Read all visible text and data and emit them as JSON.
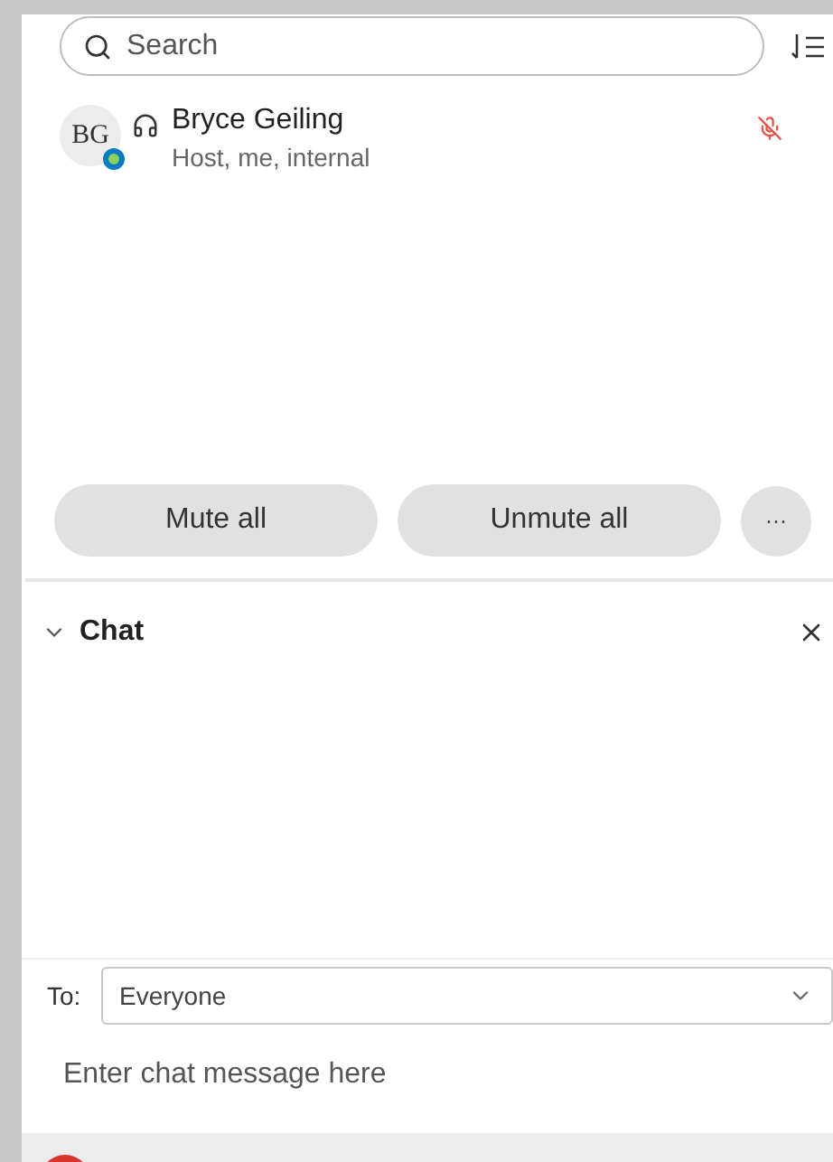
{
  "search": {
    "placeholder": "Search"
  },
  "participants": [
    {
      "initials": "BG",
      "name": "Bryce Geiling",
      "role": "Host, me, internal",
      "muted": true
    }
  ],
  "actions": [
    "Mute all",
    "Unmute all"
  ],
  "more_button": "···",
  "chat": {
    "title": "Chat",
    "expanded": true,
    "to_label": "To:",
    "recipient": "Everyone",
    "placeholder": "Enter chat message here"
  }
}
